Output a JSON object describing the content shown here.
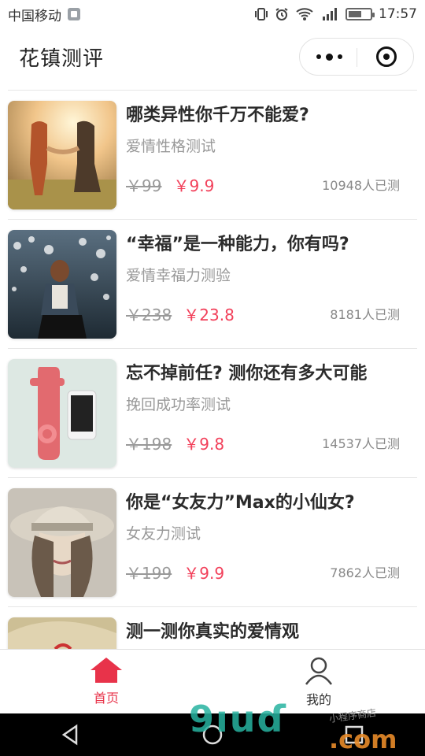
{
  "status_bar": {
    "carrier": "中国移动",
    "time": "17:57"
  },
  "nav": {
    "title": "花镇测评"
  },
  "items": [
    {
      "title": "哪类异性你千万不能爱?",
      "subtitle": "爱情性格测试",
      "old_price": "￥99",
      "new_price": "￥9.9",
      "count": "10948人已测"
    },
    {
      "title": "“幸福”是一种能力，你有吗?",
      "subtitle": "爱情幸福力测验",
      "old_price": "￥238",
      "new_price": "￥23.8",
      "count": "8181人已测"
    },
    {
      "title": "忘不掉前任? 测你还有多大可能",
      "subtitle": "挽回成功率测试",
      "old_price": "￥198",
      "new_price": "￥9.8",
      "count": "14537人已测"
    },
    {
      "title": "你是“女友力”Max的小仙女?",
      "subtitle": "女友力测试",
      "old_price": "￥199",
      "new_price": "￥9.9",
      "count": "7862人已测"
    },
    {
      "title": "测一测你真实的爱情观",
      "subtitle": "",
      "old_price": "",
      "new_price": "",
      "count": ""
    }
  ],
  "tabbar": {
    "home_label": "首页",
    "mine_label": "我的"
  },
  "watermark": {
    "main": "9ıuɗ",
    "suffix": ".com",
    "small": "小程序商店"
  },
  "colors": {
    "accent": "#f2405a",
    "tab_active": "#e8334a"
  }
}
